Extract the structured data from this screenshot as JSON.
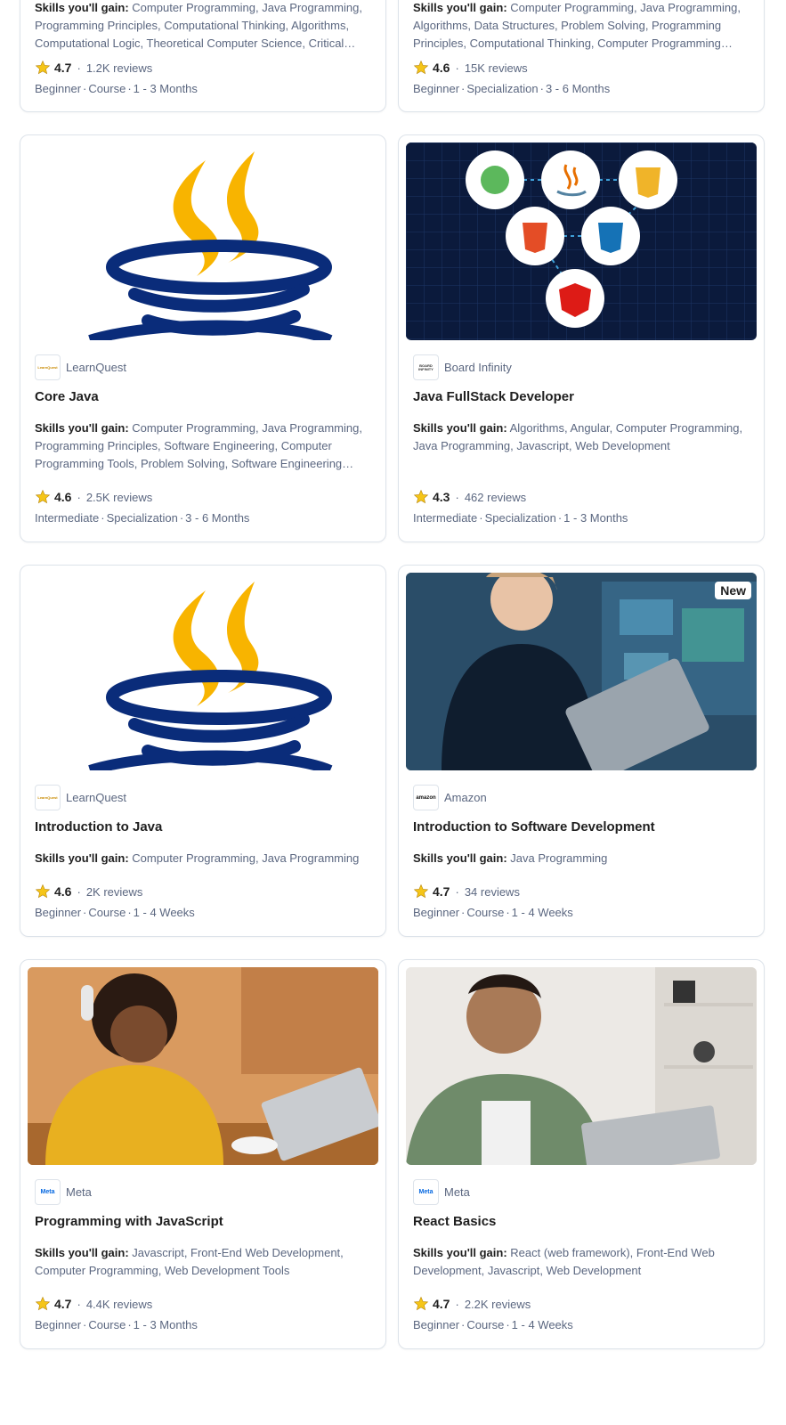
{
  "cards": [
    {
      "skills_label": "Skills you'll gain:",
      "skills": "Computer Programming, Java Programming, Programming Principles, Computational Thinking, Algorithms, Computational Logic, Theoretical Computer Science, Critical…",
      "rating": "4.7",
      "reviews": "1.2K reviews",
      "level": "Beginner",
      "type": "Course",
      "duration": "1 - 3 Months"
    },
    {
      "skills_label": "Skills you'll gain:",
      "skills": "Computer Programming, Java Programming, Algorithms, Data Structures, Problem Solving, Programming Principles, Computational Thinking, Computer Programming…",
      "rating": "4.6",
      "reviews": "15K reviews",
      "level": "Beginner",
      "type": "Specialization",
      "duration": "3 - 6 Months"
    },
    {
      "image": "java-logo",
      "partner": "LearnQuest",
      "title": "Core Java",
      "skills_label": "Skills you'll gain:",
      "skills": "Computer Programming, Java Programming, Programming Principles, Software Engineering, Computer Programming Tools, Problem Solving, Software Engineering Too…",
      "rating": "4.6",
      "reviews": "2.5K reviews",
      "level": "Intermediate",
      "type": "Specialization",
      "duration": "3 - 6 Months"
    },
    {
      "image": "fullstack-tech-icons",
      "partner": "Board Infinity",
      "title": "Java FullStack Developer",
      "skills_label": "Skills you'll gain:",
      "skills": "Algorithms, Angular, Computer Programming, Java Programming, Javascript, Web Development",
      "rating": "4.3",
      "reviews": "462 reviews",
      "level": "Intermediate",
      "type": "Specialization",
      "duration": "1 - 3 Months"
    },
    {
      "image": "java-logo",
      "partner": "LearnQuest",
      "title": "Introduction to Java",
      "skills_label": "Skills you'll gain:",
      "skills": "Computer Programming, Java Programming",
      "rating": "4.6",
      "reviews": "2K reviews",
      "level": "Beginner",
      "type": "Course",
      "duration": "1 - 4 Weeks"
    },
    {
      "image": "woman-with-laptop-photo",
      "badge": "New",
      "partner": "Amazon",
      "title": "Introduction to Software Development",
      "skills_label": "Skills you'll gain:",
      "skills": "Java Programming",
      "rating": "4.7",
      "reviews": "34 reviews",
      "level": "Beginner",
      "type": "Course",
      "duration": "1 - 4 Weeks"
    },
    {
      "image": "student-studying-photo",
      "partner": "Meta",
      "title": "Programming with JavaScript",
      "skills_label": "Skills you'll gain:",
      "skills": "Javascript, Front-End Web Development, Computer Programming, Web Development Tools",
      "rating": "4.7",
      "reviews": "4.4K reviews",
      "level": "Beginner",
      "type": "Course",
      "duration": "1 - 3 Months"
    },
    {
      "image": "man-with-laptop-photo",
      "partner": "Meta",
      "title": "React Basics",
      "skills_label": "Skills you'll gain:",
      "skills": "React (web framework), Front-End Web Development, Javascript, Web Development",
      "rating": "4.7",
      "reviews": "2.2K reviews",
      "level": "Beginner",
      "type": "Course",
      "duration": "1 - 4 Weeks"
    }
  ],
  "logos": {
    "learnquest": "LearnQuest",
    "board_infinity": "BOARD INFINITY",
    "amazon": "amazon",
    "meta": "Meta"
  },
  "icons": {
    "star": "star-icon"
  },
  "colors": {
    "star": "#f5c518",
    "text_muted": "#5b6780",
    "border": "#dde3ea"
  }
}
